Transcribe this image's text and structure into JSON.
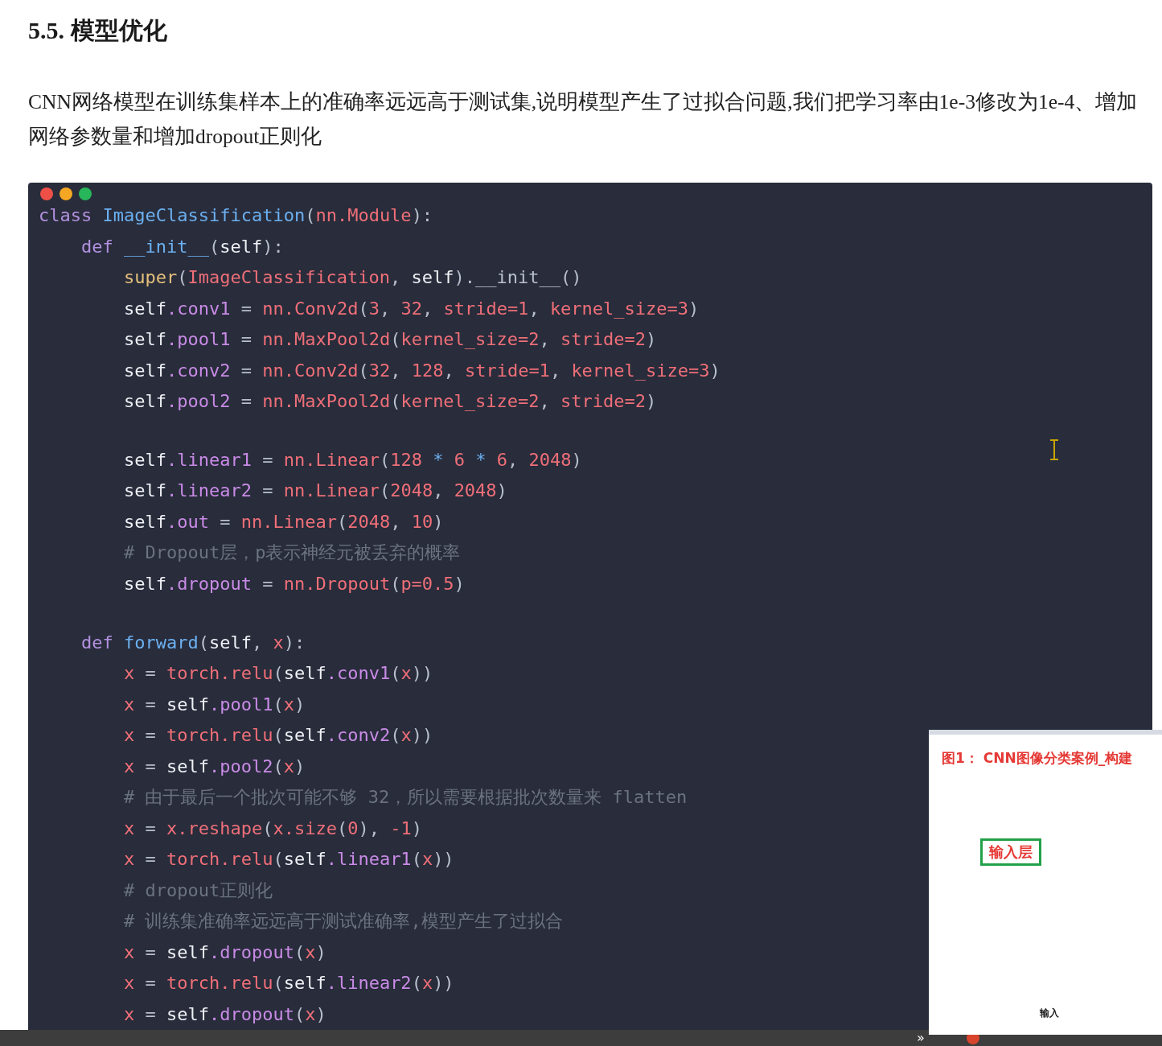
{
  "heading": "5.5. 模型优化",
  "paragraph": "CNN网络模型在训练集样本上的准确率远远高于测试集,说明模型产生了过拟合问题,我们把学习率由1e-3修改为1e-4、增加网络参数量和增加dropout正则化",
  "code_lines": [
    {
      "kind": "code",
      "tokens": [
        {
          "t": "class ",
          "kind": "keyword"
        },
        {
          "t": "ImageClassification",
          "kind": "name"
        },
        {
          "t": "(",
          "kind": "punct"
        },
        {
          "t": "nn.Module",
          "kind": "red"
        },
        {
          "t": "):",
          "kind": "punct"
        }
      ]
    },
    {
      "kind": "code",
      "tokens": [
        {
          "t": "    def ",
          "kind": "keyword"
        },
        {
          "t": "__init__",
          "kind": "name"
        },
        {
          "t": "(",
          "kind": "punct"
        },
        {
          "t": "self",
          "kind": "plain"
        },
        {
          "t": "):",
          "kind": "punct"
        }
      ]
    },
    {
      "kind": "code",
      "tokens": [
        {
          "t": "        super",
          "kind": "builtin"
        },
        {
          "t": "(",
          "kind": "punct"
        },
        {
          "t": "ImageClassification",
          "kind": "red"
        },
        {
          "t": ", ",
          "kind": "punct"
        },
        {
          "t": "self",
          "kind": "plain"
        },
        {
          "t": ").__init__()",
          "kind": "punct"
        }
      ]
    },
    {
      "kind": "code",
      "tokens": [
        {
          "t": "        self",
          "kind": "plain"
        },
        {
          "t": ".conv1",
          "kind": "attr"
        },
        {
          "t": " = ",
          "kind": "punct"
        },
        {
          "t": "nn.Conv2d",
          "kind": "red"
        },
        {
          "t": "(",
          "kind": "punct"
        },
        {
          "t": "3",
          "kind": "red"
        },
        {
          "t": ", ",
          "kind": "punct"
        },
        {
          "t": "32",
          "kind": "red"
        },
        {
          "t": ", ",
          "kind": "punct"
        },
        {
          "t": "stride=1",
          "kind": "red"
        },
        {
          "t": ", ",
          "kind": "punct"
        },
        {
          "t": "kernel_size=3",
          "kind": "red"
        },
        {
          "t": ")",
          "kind": "punct"
        }
      ]
    },
    {
      "kind": "code",
      "tokens": [
        {
          "t": "        self",
          "kind": "plain"
        },
        {
          "t": ".pool1",
          "kind": "attr"
        },
        {
          "t": " = ",
          "kind": "punct"
        },
        {
          "t": "nn.MaxPool2d",
          "kind": "red"
        },
        {
          "t": "(",
          "kind": "punct"
        },
        {
          "t": "kernel_size=2",
          "kind": "red"
        },
        {
          "t": ", ",
          "kind": "punct"
        },
        {
          "t": "stride=2",
          "kind": "red"
        },
        {
          "t": ")",
          "kind": "punct"
        }
      ]
    },
    {
      "kind": "code",
      "tokens": [
        {
          "t": "        self",
          "kind": "plain"
        },
        {
          "t": ".conv2",
          "kind": "attr"
        },
        {
          "t": " = ",
          "kind": "punct"
        },
        {
          "t": "nn.Conv2d",
          "kind": "red"
        },
        {
          "t": "(",
          "kind": "punct"
        },
        {
          "t": "32",
          "kind": "red"
        },
        {
          "t": ", ",
          "kind": "punct"
        },
        {
          "t": "128",
          "kind": "red"
        },
        {
          "t": ", ",
          "kind": "punct"
        },
        {
          "t": "stride=1",
          "kind": "red"
        },
        {
          "t": ", ",
          "kind": "punct"
        },
        {
          "t": "kernel_size=3",
          "kind": "red"
        },
        {
          "t": ")",
          "kind": "punct"
        }
      ]
    },
    {
      "kind": "code",
      "tokens": [
        {
          "t": "        self",
          "kind": "plain"
        },
        {
          "t": ".pool2",
          "kind": "attr"
        },
        {
          "t": " = ",
          "kind": "punct"
        },
        {
          "t": "nn.MaxPool2d",
          "kind": "red"
        },
        {
          "t": "(",
          "kind": "punct"
        },
        {
          "t": "kernel_size=2",
          "kind": "red"
        },
        {
          "t": ", ",
          "kind": "punct"
        },
        {
          "t": "stride=2",
          "kind": "red"
        },
        {
          "t": ")",
          "kind": "punct"
        }
      ]
    },
    {
      "kind": "blank"
    },
    {
      "kind": "code",
      "tokens": [
        {
          "t": "        self",
          "kind": "plain"
        },
        {
          "t": ".linear1",
          "kind": "attr"
        },
        {
          "t": " = ",
          "kind": "punct"
        },
        {
          "t": "nn.Linear",
          "kind": "red"
        },
        {
          "t": "(",
          "kind": "punct"
        },
        {
          "t": "128",
          "kind": "red"
        },
        {
          "t": " * ",
          "kind": "name"
        },
        {
          "t": "6",
          "kind": "red"
        },
        {
          "t": " * ",
          "kind": "name"
        },
        {
          "t": "6",
          "kind": "red"
        },
        {
          "t": ", ",
          "kind": "punct"
        },
        {
          "t": "2048",
          "kind": "red"
        },
        {
          "t": ")",
          "kind": "punct"
        }
      ]
    },
    {
      "kind": "code",
      "tokens": [
        {
          "t": "        self",
          "kind": "plain"
        },
        {
          "t": ".linear2",
          "kind": "attr"
        },
        {
          "t": " = ",
          "kind": "punct"
        },
        {
          "t": "nn.Linear",
          "kind": "red"
        },
        {
          "t": "(",
          "kind": "punct"
        },
        {
          "t": "2048",
          "kind": "red"
        },
        {
          "t": ", ",
          "kind": "punct"
        },
        {
          "t": "2048",
          "kind": "red"
        },
        {
          "t": ")",
          "kind": "punct"
        }
      ]
    },
    {
      "kind": "code",
      "tokens": [
        {
          "t": "        self",
          "kind": "plain"
        },
        {
          "t": ".out",
          "kind": "attr"
        },
        {
          "t": " = ",
          "kind": "punct"
        },
        {
          "t": "nn.Linear",
          "kind": "red"
        },
        {
          "t": "(",
          "kind": "punct"
        },
        {
          "t": "2048",
          "kind": "red"
        },
        {
          "t": ", ",
          "kind": "punct"
        },
        {
          "t": "10",
          "kind": "red"
        },
        {
          "t": ")",
          "kind": "punct"
        }
      ]
    },
    {
      "kind": "code",
      "tokens": [
        {
          "t": "        # Dropout层，p表示神经元被丢弃的概率",
          "kind": "comment"
        }
      ]
    },
    {
      "kind": "code",
      "tokens": [
        {
          "t": "        self",
          "kind": "plain"
        },
        {
          "t": ".dropout",
          "kind": "attr"
        },
        {
          "t": " = ",
          "kind": "punct"
        },
        {
          "t": "nn.Dropout",
          "kind": "red"
        },
        {
          "t": "(",
          "kind": "punct"
        },
        {
          "t": "p=0.5",
          "kind": "red"
        },
        {
          "t": ")",
          "kind": "punct"
        }
      ]
    },
    {
      "kind": "blank"
    },
    {
      "kind": "code",
      "tokens": [
        {
          "t": "    def ",
          "kind": "keyword"
        },
        {
          "t": "forward",
          "kind": "name"
        },
        {
          "t": "(",
          "kind": "punct"
        },
        {
          "t": "self",
          "kind": "plain"
        },
        {
          "t": ", ",
          "kind": "punct"
        },
        {
          "t": "x",
          "kind": "red"
        },
        {
          "t": "):",
          "kind": "punct"
        }
      ]
    },
    {
      "kind": "code",
      "tokens": [
        {
          "t": "        x",
          "kind": "red"
        },
        {
          "t": " = ",
          "kind": "punct"
        },
        {
          "t": "torch.relu",
          "kind": "red"
        },
        {
          "t": "(",
          "kind": "punct"
        },
        {
          "t": "self",
          "kind": "plain"
        },
        {
          "t": ".conv1",
          "kind": "attr"
        },
        {
          "t": "(",
          "kind": "punct"
        },
        {
          "t": "x",
          "kind": "red"
        },
        {
          "t": "))",
          "kind": "punct"
        }
      ]
    },
    {
      "kind": "code",
      "tokens": [
        {
          "t": "        x",
          "kind": "red"
        },
        {
          "t": " = ",
          "kind": "punct"
        },
        {
          "t": "self",
          "kind": "plain"
        },
        {
          "t": ".pool1",
          "kind": "attr"
        },
        {
          "t": "(",
          "kind": "punct"
        },
        {
          "t": "x",
          "kind": "red"
        },
        {
          "t": ")",
          "kind": "punct"
        }
      ]
    },
    {
      "kind": "code",
      "tokens": [
        {
          "t": "        x",
          "kind": "red"
        },
        {
          "t": " = ",
          "kind": "punct"
        },
        {
          "t": "torch.relu",
          "kind": "red"
        },
        {
          "t": "(",
          "kind": "punct"
        },
        {
          "t": "self",
          "kind": "plain"
        },
        {
          "t": ".conv2",
          "kind": "attr"
        },
        {
          "t": "(",
          "kind": "punct"
        },
        {
          "t": "x",
          "kind": "red"
        },
        {
          "t": "))",
          "kind": "punct"
        }
      ]
    },
    {
      "kind": "code",
      "tokens": [
        {
          "t": "        x",
          "kind": "red"
        },
        {
          "t": " = ",
          "kind": "punct"
        },
        {
          "t": "self",
          "kind": "plain"
        },
        {
          "t": ".pool2",
          "kind": "attr"
        },
        {
          "t": "(",
          "kind": "punct"
        },
        {
          "t": "x",
          "kind": "red"
        },
        {
          "t": ")",
          "kind": "punct"
        }
      ]
    },
    {
      "kind": "code",
      "tokens": [
        {
          "t": "        # 由于最后一个批次可能不够 32，所以需要根据批次数量来 flatten",
          "kind": "comment"
        }
      ]
    },
    {
      "kind": "code",
      "tokens": [
        {
          "t": "        x",
          "kind": "red"
        },
        {
          "t": " = ",
          "kind": "punct"
        },
        {
          "t": "x.reshape",
          "kind": "red"
        },
        {
          "t": "(",
          "kind": "punct"
        },
        {
          "t": "x.size",
          "kind": "red"
        },
        {
          "t": "(",
          "kind": "punct"
        },
        {
          "t": "0",
          "kind": "red"
        },
        {
          "t": "), ",
          "kind": "punct"
        },
        {
          "t": "-1",
          "kind": "red"
        },
        {
          "t": ")",
          "kind": "punct"
        }
      ]
    },
    {
      "kind": "code",
      "tokens": [
        {
          "t": "        x",
          "kind": "red"
        },
        {
          "t": " = ",
          "kind": "punct"
        },
        {
          "t": "torch.relu",
          "kind": "red"
        },
        {
          "t": "(",
          "kind": "punct"
        },
        {
          "t": "self",
          "kind": "plain"
        },
        {
          "t": ".linear1",
          "kind": "attr"
        },
        {
          "t": "(",
          "kind": "punct"
        },
        {
          "t": "x",
          "kind": "red"
        },
        {
          "t": "))",
          "kind": "punct"
        }
      ]
    },
    {
      "kind": "code",
      "tokens": [
        {
          "t": "        # dropout正则化",
          "kind": "comment"
        }
      ]
    },
    {
      "kind": "code",
      "tokens": [
        {
          "t": "        # 训练集准确率远远高于测试准确率,模型产生了过拟合",
          "kind": "comment"
        }
      ]
    },
    {
      "kind": "code",
      "tokens": [
        {
          "t": "        x",
          "kind": "red"
        },
        {
          "t": " = ",
          "kind": "punct"
        },
        {
          "t": "self",
          "kind": "plain"
        },
        {
          "t": ".dropout",
          "kind": "attr"
        },
        {
          "t": "(",
          "kind": "punct"
        },
        {
          "t": "x",
          "kind": "red"
        },
        {
          "t": ")",
          "kind": "punct"
        }
      ]
    },
    {
      "kind": "code",
      "tokens": [
        {
          "t": "        x",
          "kind": "red"
        },
        {
          "t": " = ",
          "kind": "punct"
        },
        {
          "t": "torch.relu",
          "kind": "red"
        },
        {
          "t": "(",
          "kind": "punct"
        },
        {
          "t": "self",
          "kind": "plain"
        },
        {
          "t": ".linear2",
          "kind": "attr"
        },
        {
          "t": "(",
          "kind": "punct"
        },
        {
          "t": "x",
          "kind": "red"
        },
        {
          "t": "))",
          "kind": "punct"
        }
      ]
    },
    {
      "kind": "code",
      "tokens": [
        {
          "t": "        x",
          "kind": "red"
        },
        {
          "t": " = ",
          "kind": "punct"
        },
        {
          "t": "self",
          "kind": "plain"
        },
        {
          "t": ".dropout",
          "kind": "attr"
        },
        {
          "t": "(",
          "kind": "punct"
        },
        {
          "t": "x",
          "kind": "red"
        },
        {
          "t": ")",
          "kind": "punct"
        }
      ]
    }
  ],
  "video_overlay": {
    "slide_title": "图1： CNN图像分类案例_构建",
    "layer_box": "输入层",
    "small_label": "输入"
  },
  "taskbar": {
    "chevron": "»"
  }
}
